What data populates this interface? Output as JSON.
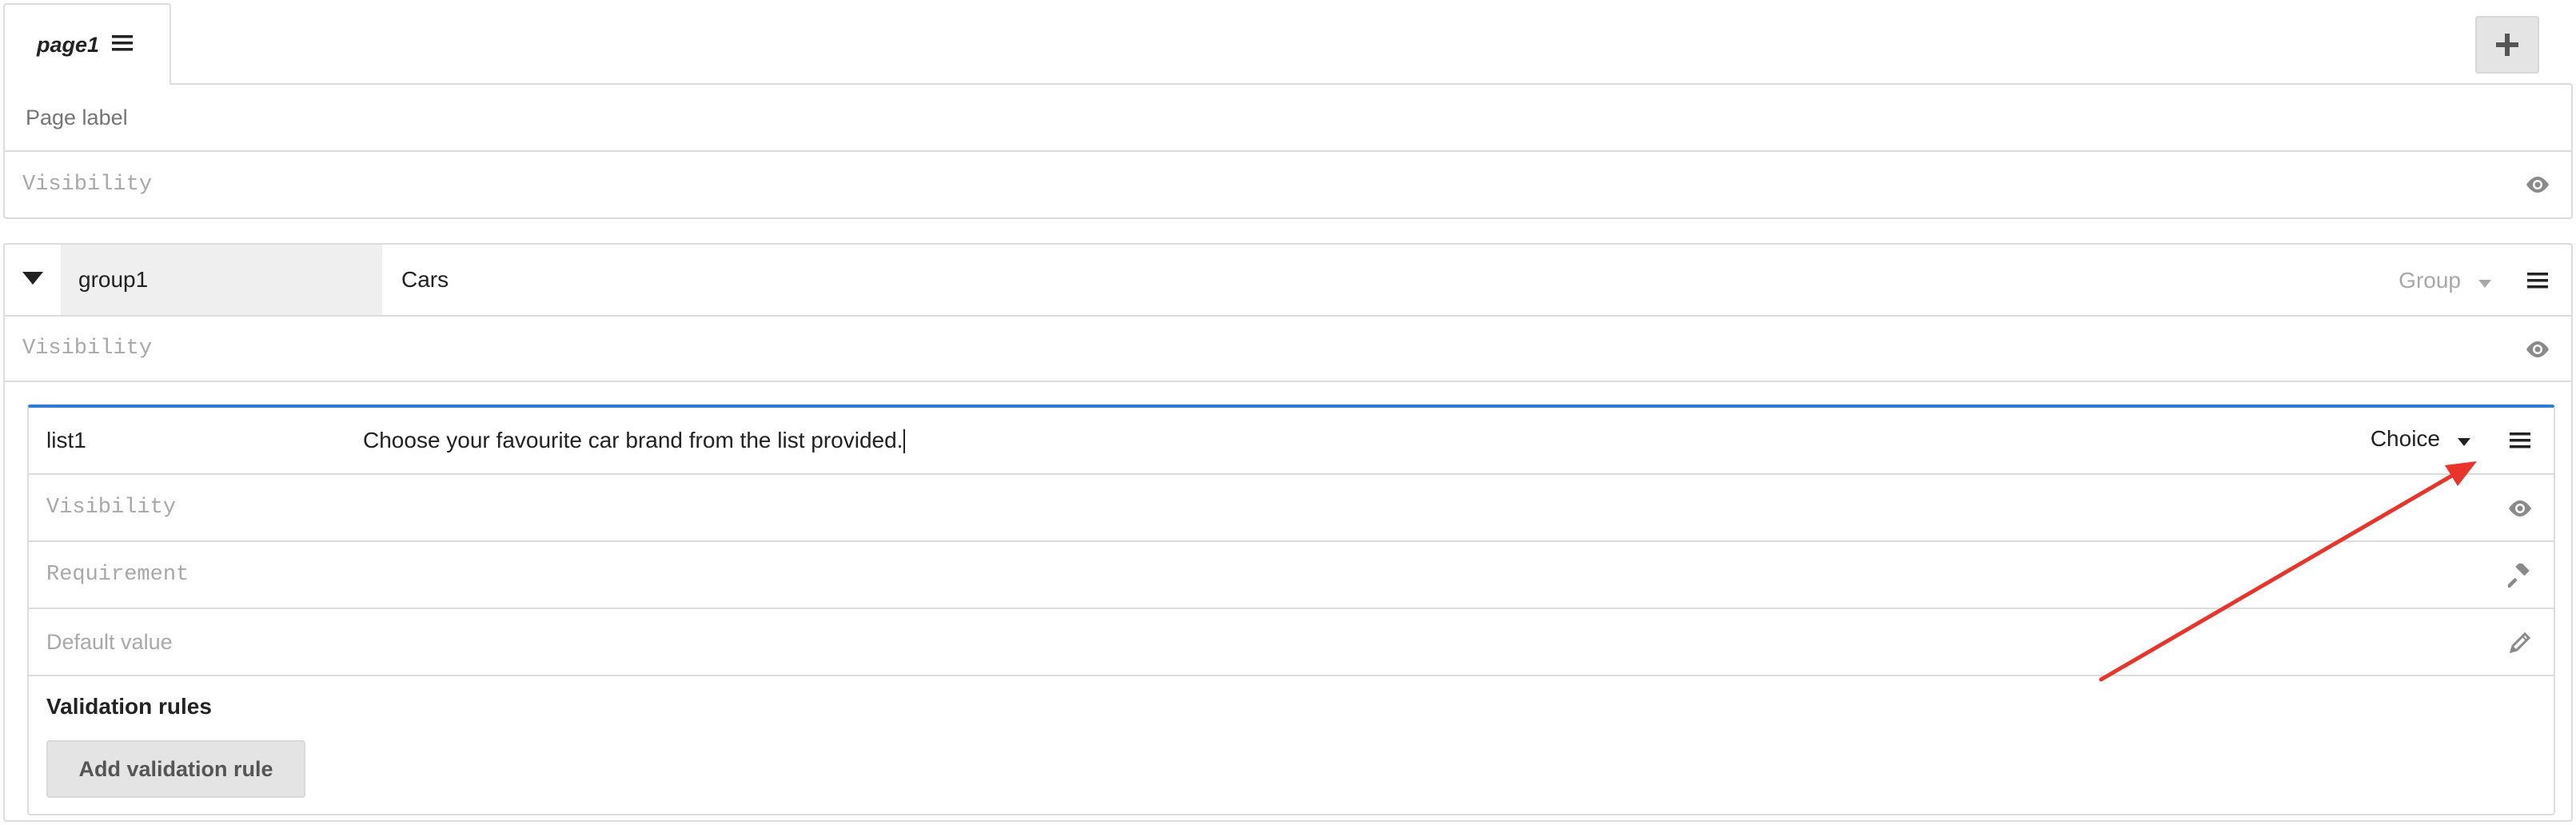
{
  "tabs": [
    {
      "label": "page1"
    }
  ],
  "page": {
    "label_placeholder": "Page label",
    "visibility_placeholder": "Visibility"
  },
  "group": {
    "name": "group1",
    "label": "Cars",
    "type": "Group",
    "visibility_placeholder": "Visibility"
  },
  "field": {
    "name": "list1",
    "label": "Choose your favourite car brand from the list provided.",
    "type": "Choice",
    "visibility_placeholder": "Visibility",
    "requirement_placeholder": "Requirement",
    "default_value_placeholder": "Default value",
    "validation_title": "Validation rules",
    "add_rule_label": "Add validation rule"
  },
  "icons": {
    "add": "plus-icon",
    "menu": "hamburger-icon",
    "visibility": "eye-icon",
    "requirement": "gavel-icon",
    "default_value": "pencil-icon",
    "collapse": "caret-down-icon",
    "dropdown": "chevron-down-icon"
  },
  "colors": {
    "active_border": "#2e7bd6",
    "annotation_arrow": "#e8342a",
    "placeholder": "#a8a8a8",
    "button_bg": "#e4e4e4"
  }
}
